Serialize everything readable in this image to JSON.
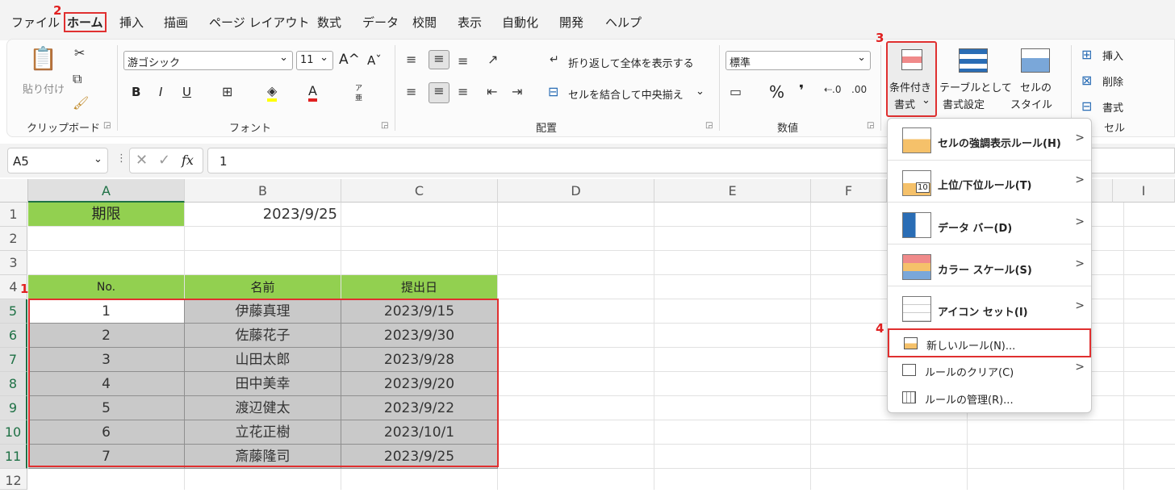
{
  "menubar": {
    "tabs": [
      "ファイル",
      "ホーム",
      "挿入",
      "描画",
      "ページ レイアウト",
      "数式",
      "データ",
      "校閲",
      "表示",
      "自動化",
      "開発",
      "ヘルプ"
    ]
  },
  "steps": [
    "1",
    "2",
    "3",
    "4"
  ],
  "ribbon": {
    "clipboard": {
      "paste": "貼り付け",
      "group": "クリップボード"
    },
    "font": {
      "name": "游ゴシック",
      "size": "11",
      "grow": "A^",
      "shrink": "Aˇ",
      "bold": "B",
      "italic": "I",
      "underline": "U",
      "font_color": "A",
      "phonetic_top": "ア",
      "phonetic_bottom": "亜",
      "group": "フォント"
    },
    "alignment": {
      "wrap": "折り返して全体を表示する",
      "merge": "セルを結合して中央揃え",
      "group": "配置"
    },
    "number": {
      "format": "標準",
      "percent": "%",
      "comma": "❜",
      "group": "数値"
    },
    "styles": {
      "cf_line1": "条件付き",
      "cf_line2": "書式",
      "table_line1": "テーブルとして",
      "table_line2": "書式設定",
      "cellstyle_line1": "セルの",
      "cellstyle_line2": "スタイル"
    },
    "cells": {
      "insert": "挿入",
      "delete": "削除",
      "format": "書式",
      "group": "セル"
    }
  },
  "formula_bar": {
    "name_box": "A5",
    "fx": "fx",
    "content": "1"
  },
  "columns": [
    "A",
    "B",
    "C",
    "D",
    "E",
    "F",
    "G",
    "H",
    "I"
  ],
  "rows": [
    "1",
    "2",
    "3",
    "4",
    "5",
    "6",
    "7",
    "8",
    "9",
    "10",
    "11",
    "12"
  ],
  "cells": {
    "deadline_label": "期限",
    "deadline_value": "2023/9/25",
    "headers": [
      "No.",
      "名前",
      "提出日"
    ],
    "data": [
      [
        "1",
        "伊藤真理",
        "2023/9/15"
      ],
      [
        "2",
        "佐藤花子",
        "2023/9/30"
      ],
      [
        "3",
        "山田太郎",
        "2023/9/28"
      ],
      [
        "4",
        "田中美幸",
        "2023/9/20"
      ],
      [
        "5",
        "渡辺健太",
        "2023/9/22"
      ],
      [
        "6",
        "立花正樹",
        "2023/10/1"
      ],
      [
        "7",
        "斎藤隆司",
        "2023/9/25"
      ]
    ]
  },
  "cf_menu": {
    "items": [
      {
        "label": "セルの強調表示ルール(H)"
      },
      {
        "label": "上位/下位ルール(T)",
        "icon_text": "10"
      },
      {
        "label": "データ バー(D)"
      },
      {
        "label": "カラー スケール(S)"
      },
      {
        "label": "アイコン セット(I)"
      }
    ],
    "new_rule": "新しいルール(N)...",
    "clear_rules": "ルールのクリア(C)",
    "manage_rules": "ルールの管理(R)..."
  },
  "colors": {
    "green": "#92d050",
    "highlight_red": "#e03030",
    "gray_cell": "#c9c9c9"
  }
}
